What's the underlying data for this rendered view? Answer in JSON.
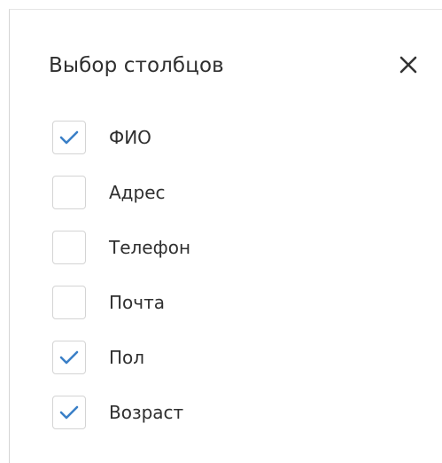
{
  "dialog": {
    "title": "Выбор столбцов",
    "close_icon": "close-icon",
    "check_color": "#3a7fc7",
    "columns": [
      {
        "label": "ФИО",
        "checked": true
      },
      {
        "label": "Адрес",
        "checked": false
      },
      {
        "label": "Телефон",
        "checked": false
      },
      {
        "label": "Почта",
        "checked": false
      },
      {
        "label": "Пол",
        "checked": true
      },
      {
        "label": "Возраст",
        "checked": true
      }
    ]
  }
}
